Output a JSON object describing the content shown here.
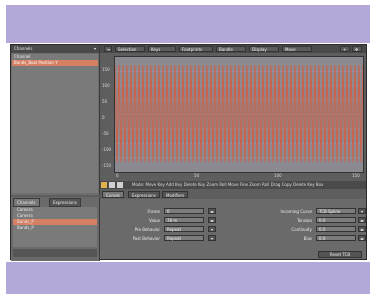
{
  "left_panel": {
    "header": "Channels",
    "channels": [
      {
        "label": "Channel",
        "selected": false
      },
      {
        "label": "Bands_Bool Position Y",
        "selected": true
      }
    ],
    "bottom_tabs": [
      "Channels",
      "Expressions"
    ],
    "tree": [
      "Camera",
      "Camera",
      "Bands_P",
      "Bands_P"
    ]
  },
  "toolbar": {
    "buttons": [
      "Selection",
      "Keys",
      "Footprints",
      "Bandle",
      "Display",
      "Move"
    ]
  },
  "graph": {
    "y_ticks": [
      "150",
      "100",
      "50",
      "0",
      "-50",
      "-100",
      "-150"
    ],
    "x_ticks": [
      "0",
      "50",
      "100",
      "150"
    ],
    "colors": {
      "background": "#8a8a90",
      "curve": "#c86450",
      "grid": "#a0a0a8"
    }
  },
  "key_bar": {
    "text": "Mode: Move Key Add Key Delete Key Zoom Roll Move Fine Zoom Roll Drag Copy Delete Key Box"
  },
  "panel_tabs": [
    "Curves",
    "Expressions",
    "Modifiers"
  ],
  "panel": {
    "frame_label": "Frame",
    "frame_value": "0",
    "value_label": "Value",
    "value_value": "78 m",
    "pre_label": "Pre Behavior",
    "pre_value": "Repeat",
    "post_label": "Post Behavior",
    "post_value": "Repeat",
    "incoming_label": "Incoming Curve",
    "incoming_value": "TCB Spline",
    "tension_label": "Tension",
    "tension_value": "0.0",
    "continuity_label": "Continuity",
    "continuity_value": "0.0",
    "bias_label": "Bias",
    "bias_value": "0.0",
    "reset_label": "Reset TCB"
  }
}
